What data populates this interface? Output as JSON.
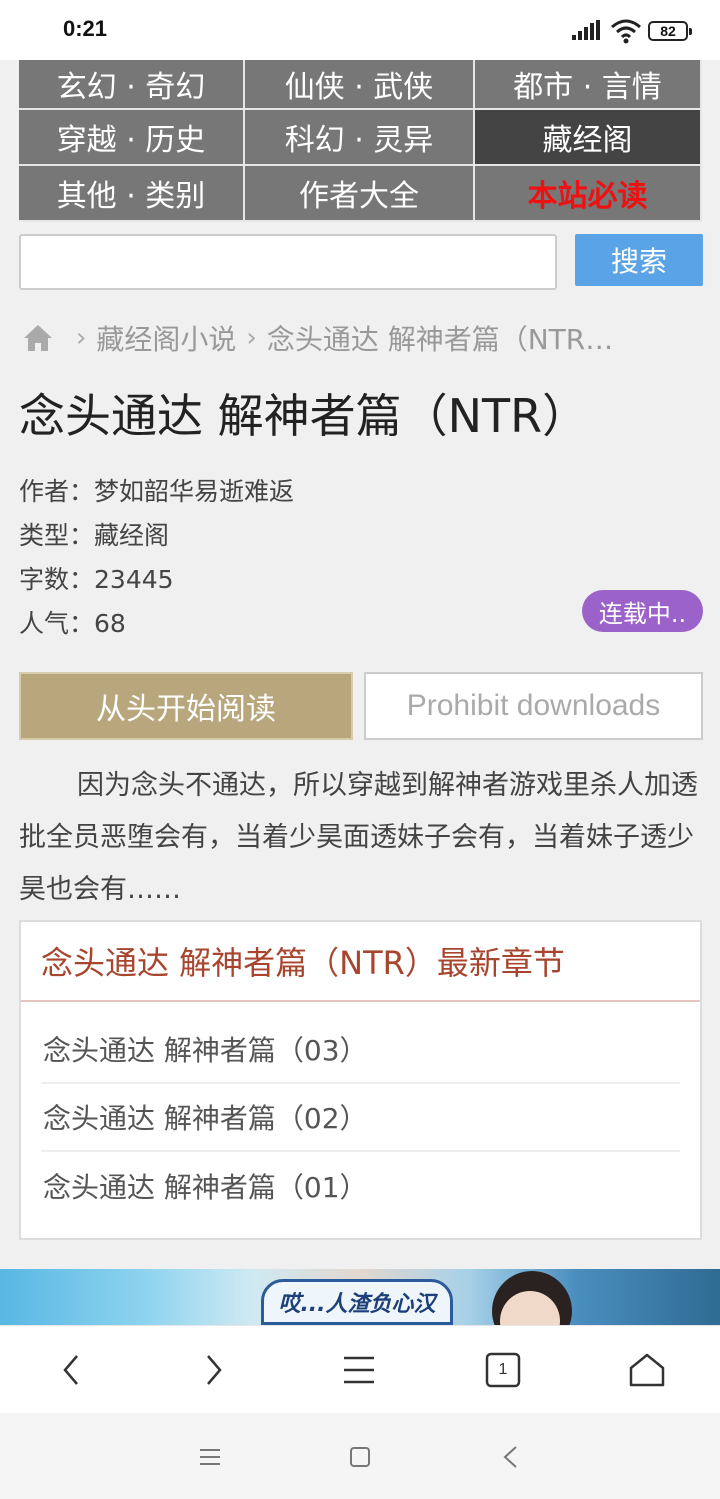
{
  "status_bar": {
    "time": "0:21",
    "battery": "82"
  },
  "nav": {
    "items": [
      {
        "label": "玄幻 · 奇幻"
      },
      {
        "label": "仙侠 · 武侠"
      },
      {
        "label": "都市 · 言情"
      },
      {
        "label": "穿越 · 历史"
      },
      {
        "label": "科幻 · 灵异"
      },
      {
        "label": "藏经阁"
      },
      {
        "label": "其他 · 类别"
      },
      {
        "label": "作者大全"
      },
      {
        "label": "本站必读"
      }
    ]
  },
  "search": {
    "placeholder": "",
    "button_label": "搜索"
  },
  "breadcrumb": {
    "category": "藏经阁小说",
    "current": "念头通达 解神者篇（NTR…"
  },
  "book": {
    "title": "念头通达 解神者篇（NTR）",
    "author_label": "作者：",
    "author": "梦如韶华易逝难返",
    "type_label": "类型：",
    "type": "藏经阁",
    "words_label": "字数：",
    "words": "23445",
    "popularity_label": "人气：",
    "popularity": "68",
    "status": "连载中..",
    "description": "因为念头不通达，所以穿越到解神者游戏里杀人加透批全员恶堕会有，当着少昊面透妹子会有，当着妹子透少昊也会有……"
  },
  "actions": {
    "read_label": "从头开始阅读",
    "download_label": "Prohibit downloads"
  },
  "chapters": {
    "heading": "念头通达 解神者篇（NTR）最新章节",
    "items": [
      {
        "label": "念头通达 解神者篇（03）"
      },
      {
        "label": "念头通达 解神者篇（02）"
      },
      {
        "label": "念头通达 解神者篇（01）"
      }
    ]
  },
  "banner": {
    "text": "哎...人渣负心汉"
  },
  "browser_bar": {
    "tab_count": "1"
  },
  "colors": {
    "nav_bg": "#777777",
    "nav_active": "#444444",
    "accent_blue": "#5aa3e6",
    "read_btn": "#b8a77d",
    "badge": "#9b63c9",
    "chapter_heading": "#a8452e"
  }
}
